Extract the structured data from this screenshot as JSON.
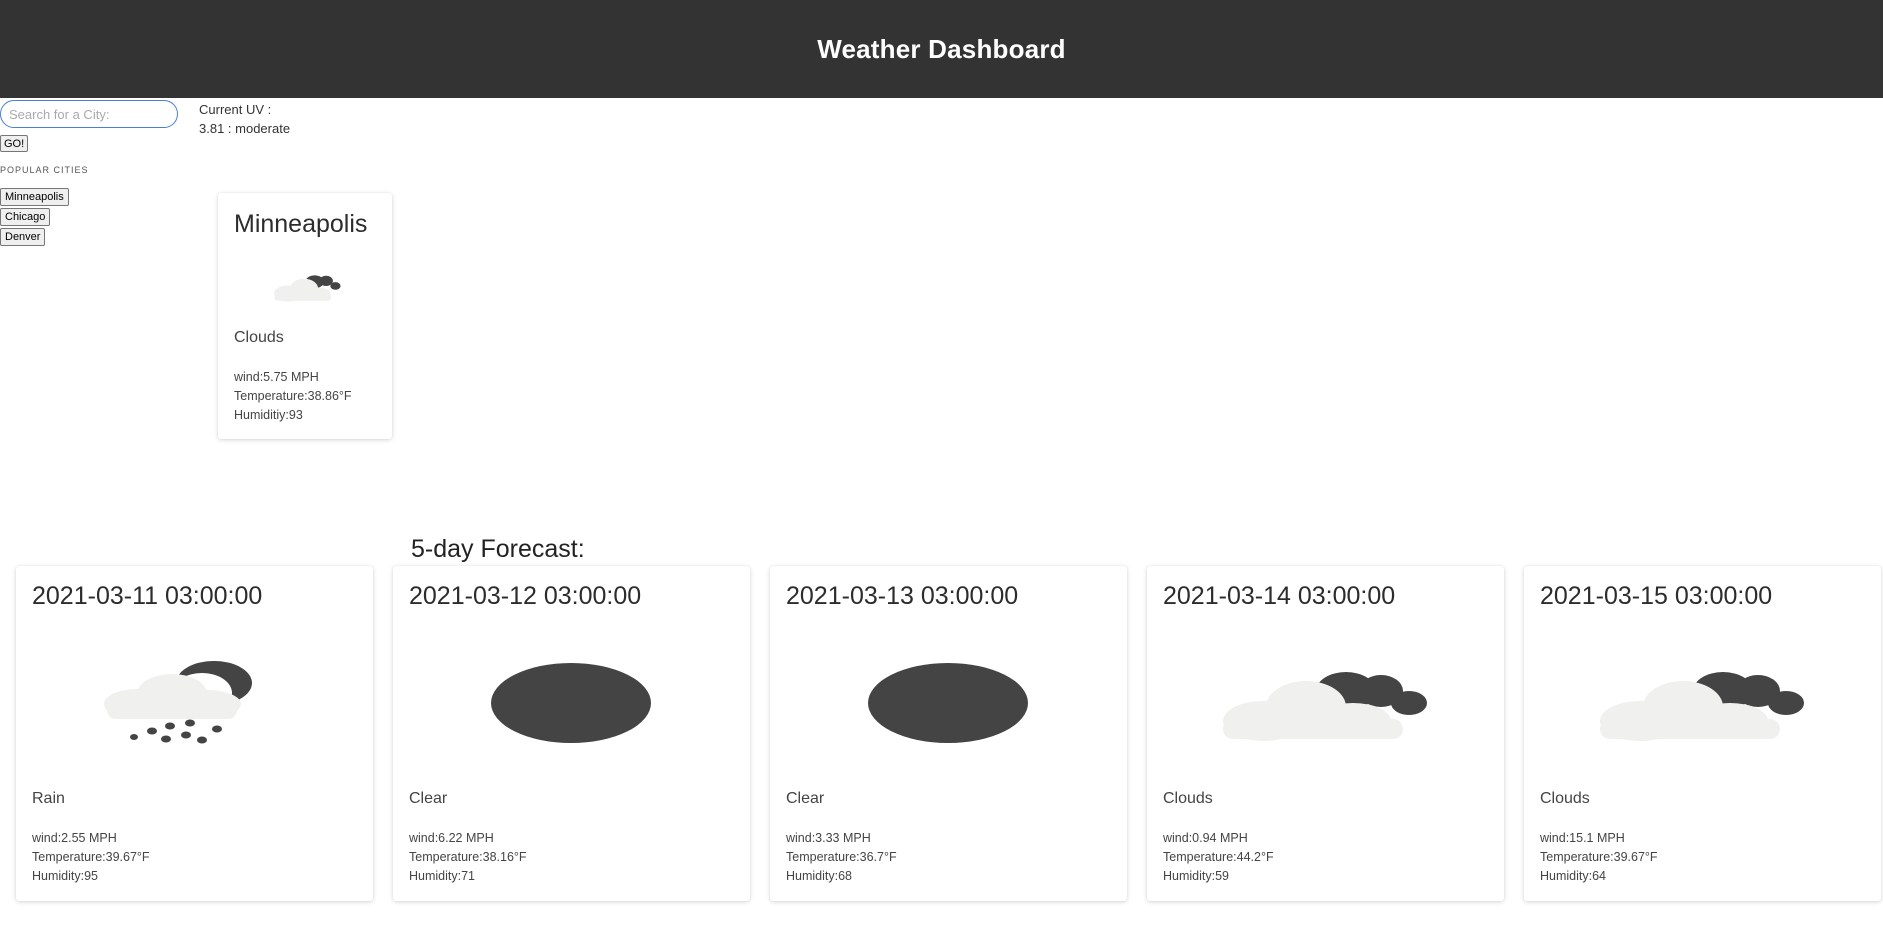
{
  "header": {
    "title": "Weather Dashboard"
  },
  "search": {
    "placeholder": "Search for a City:",
    "value": "",
    "go_label": "GO!"
  },
  "popular": {
    "title": "POPULAR CITIES",
    "cities": [
      "Minneapolis",
      "Chicago",
      "Denver"
    ]
  },
  "uv": {
    "label": "Current UV :",
    "value": "3.81 : moderate"
  },
  "current": {
    "city": "Minneapolis",
    "icon": "clouds-icon",
    "condition": "Clouds",
    "wind": "wind:5.75 MPH",
    "temperature": "Temperature:38.86°F",
    "humidity": "Humiditiy:93"
  },
  "forecast": {
    "title": "5-day Forecast:",
    "days": [
      {
        "date": "2021-03-11 03:00:00",
        "icon": "rain-icon",
        "condition": "Rain",
        "wind": "wind:2.55 MPH",
        "temperature": "Temperature:39.67°F",
        "humidity": "Humidity:95"
      },
      {
        "date": "2021-03-12 03:00:00",
        "icon": "clear-icon",
        "condition": "Clear",
        "wind": "wind:6.22 MPH",
        "temperature": "Temperature:38.16°F",
        "humidity": "Humidity:71"
      },
      {
        "date": "2021-03-13 03:00:00",
        "icon": "clear-icon",
        "condition": "Clear",
        "wind": "wind:3.33 MPH",
        "temperature": "Temperature:36.7°F",
        "humidity": "Humidity:68"
      },
      {
        "date": "2021-03-14 03:00:00",
        "icon": "clouds-icon",
        "condition": "Clouds",
        "wind": "wind:0.94 MPH",
        "temperature": "Temperature:44.2°F",
        "humidity": "Humidity:59"
      },
      {
        "date": "2021-03-15 03:00:00",
        "icon": "clouds-icon",
        "condition": "Clouds",
        "wind": "wind:15.1 MPH",
        "temperature": "Temperature:39.67°F",
        "humidity": "Humidity:64"
      }
    ]
  },
  "colors": {
    "header_bg": "#333333",
    "header_text": "#ffffff",
    "icon_dark": "#444444",
    "icon_light": "#f0f0ef",
    "focus_border": "#4a7fd6"
  }
}
